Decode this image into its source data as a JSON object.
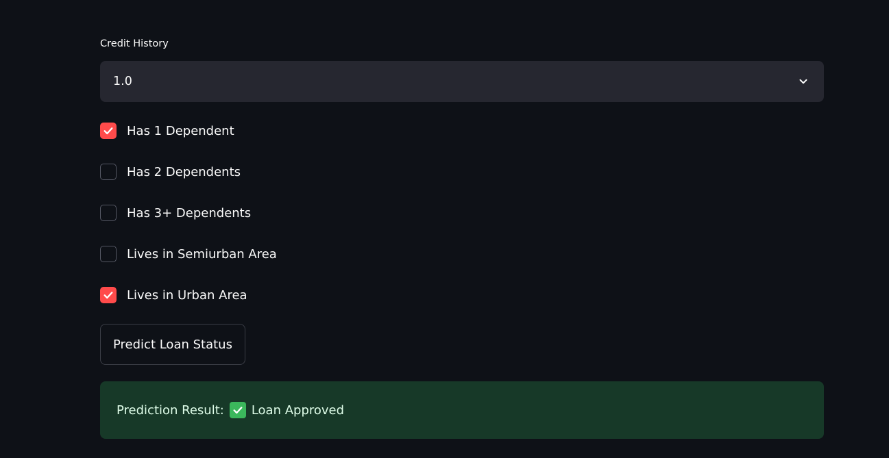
{
  "credit_history": {
    "label": "Credit History",
    "selected_value": "1.0",
    "icon": "chevron-down-icon"
  },
  "checkboxes": [
    {
      "label": "Has 1 Dependent",
      "checked": true
    },
    {
      "label": "Has 2 Dependents",
      "checked": false
    },
    {
      "label": "Has 3+ Dependents",
      "checked": false
    },
    {
      "label": "Lives in Semiurban Area",
      "checked": false
    },
    {
      "label": "Lives in Urban Area",
      "checked": true
    }
  ],
  "predict_button": {
    "label": "Predict Loan Status"
  },
  "result": {
    "prefix": "Prediction Result:",
    "icon": "check-mark-button-icon",
    "status": "Loan Approved"
  },
  "colors": {
    "background": "#0e1117",
    "accent": "#ff4b4b",
    "select_bg": "#262730",
    "success_bg": "#173928",
    "success_text": "#dffde9"
  }
}
